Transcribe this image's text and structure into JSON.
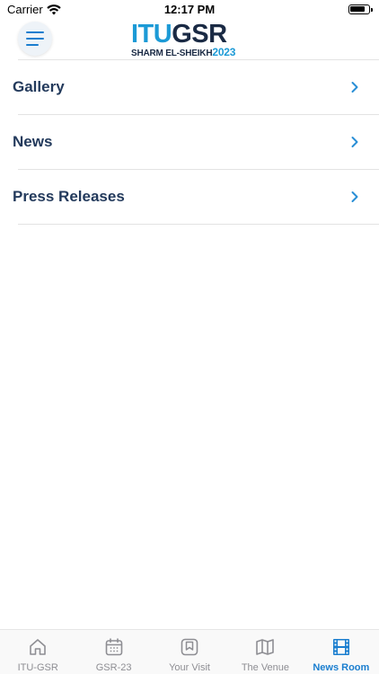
{
  "status_bar": {
    "carrier": "Carrier",
    "time": "12:17 PM"
  },
  "header": {
    "menu_icon": "hamburger-icon",
    "logo": {
      "itu": "ITU",
      "gsr": "GSR",
      "location": "SHARM EL-SHEIKH",
      "year": "2023"
    }
  },
  "menu": {
    "items": [
      {
        "label": "Gallery",
        "icon": "chevron-right-icon"
      },
      {
        "label": "News",
        "icon": "chevron-right-icon"
      },
      {
        "label": "Press Releases",
        "icon": "chevron-right-icon"
      }
    ]
  },
  "tab_bar": {
    "tabs": [
      {
        "label": "ITU-GSR",
        "icon": "home-icon",
        "active": false
      },
      {
        "label": "GSR-23",
        "icon": "calendar-icon",
        "active": false
      },
      {
        "label": "Your Visit",
        "icon": "bookmark-icon",
        "active": false
      },
      {
        "label": "The Venue",
        "icon": "map-icon",
        "active": false
      },
      {
        "label": "News Room",
        "icon": "film-icon",
        "active": true
      }
    ]
  },
  "colors": {
    "accent": "#1a7ecf",
    "chevron": "#2a8fd6",
    "heading": "#233a5c",
    "logo_blue": "#1c9ad6",
    "logo_dark": "#1a2a44",
    "inactive_tab": "#8e8e93"
  }
}
